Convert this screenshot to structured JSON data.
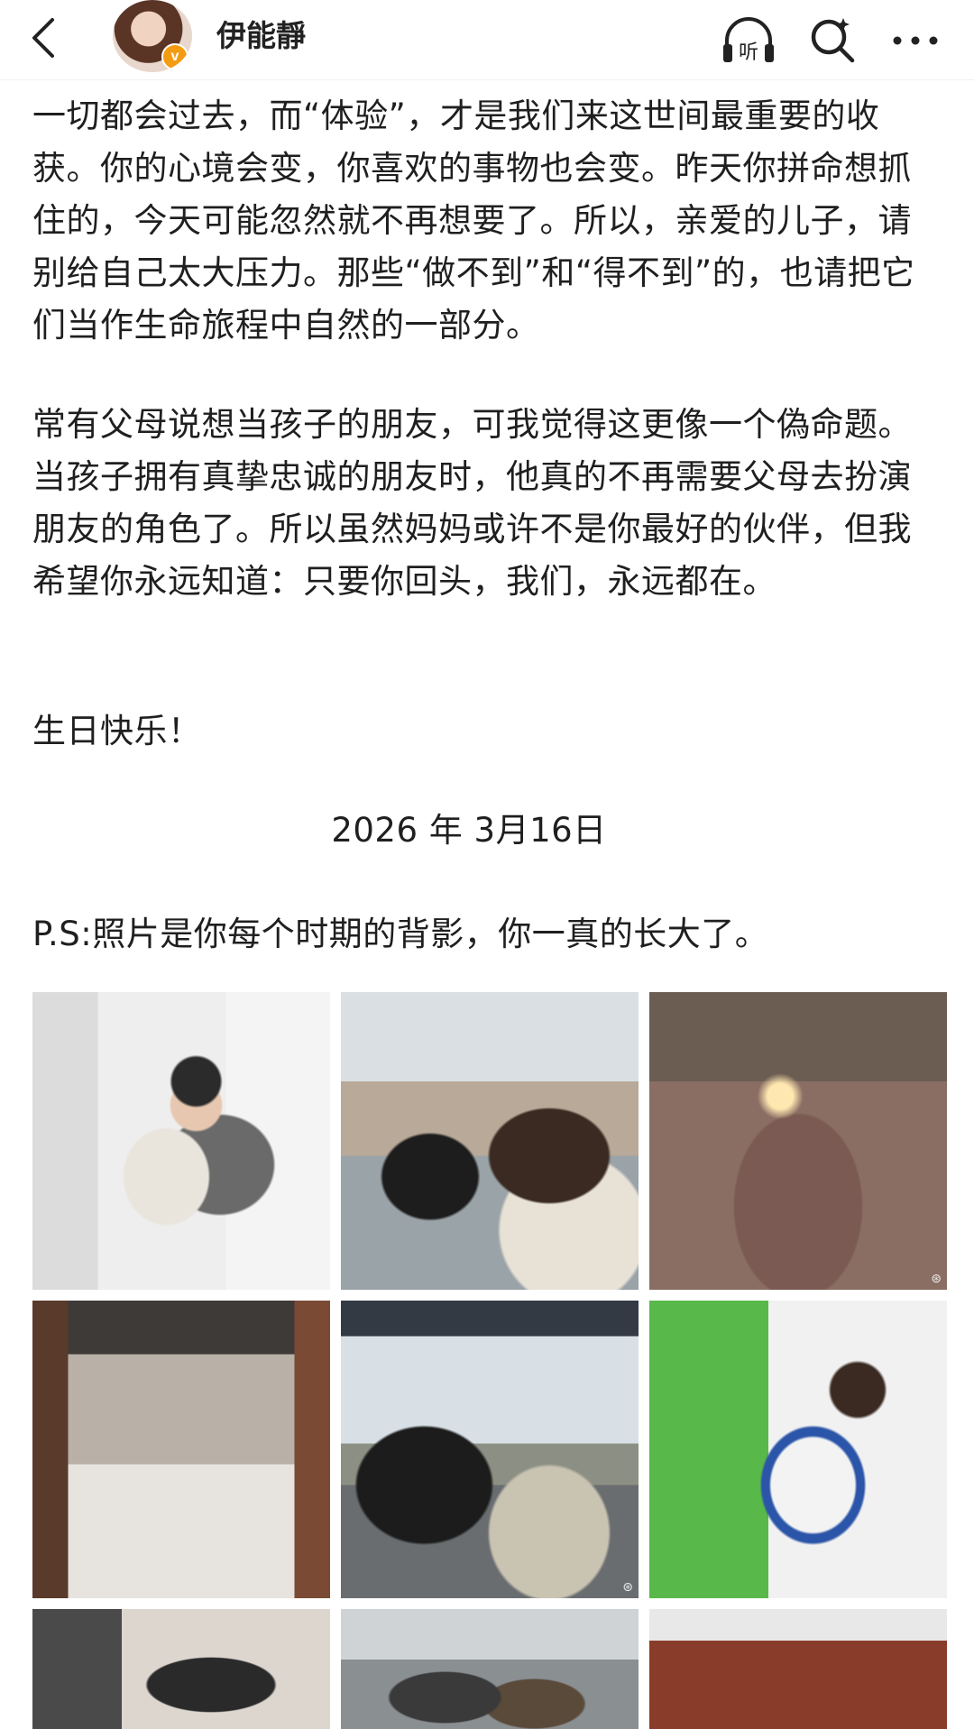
{
  "header": {
    "username": "伊能靜",
    "avatar_badge": "v",
    "icons": {
      "back": "chevron-left-icon",
      "listen": "headphones-listen-icon",
      "listen_label": "听",
      "search": "search-icon",
      "more": "more-dots-icon"
    }
  },
  "post": {
    "paragraph1": "一切都会过去，而“体验”，才是我们来这世间最重要的收获。你的心境会变，你喜欢的事物也会变。昨天你拼命想抓住的，今天可能忽然就不再想要了。所以，亲爱的儿子，请别给自己太大压力。那些“做不到”和“得不到”的，也请把它们当作生命旅程中自然的一部分。",
    "paragraph2": "常有父母说想当孩子的朋友，可我觉得这更像一个偽命题。当孩子拥有真挚忠诚的朋友时，他真的不再需要父母去扮演朋友的角色了。所以虽然妈妈或许不是你最好的伙伴，但我希望你永远知道：只要你回头，我们，永远都在。",
    "paragraph3": "生日快乐！",
    "date": "2026 年 3月16日",
    "ps": "P.S:照片是你每个时期的背影，你一真的长大了。"
  },
  "photos": [
    {
      "name": "photo-1"
    },
    {
      "name": "photo-2"
    },
    {
      "name": "photo-3",
      "watermark": "⊛"
    },
    {
      "name": "photo-4"
    },
    {
      "name": "photo-5",
      "watermark": "⊛"
    },
    {
      "name": "photo-6"
    },
    {
      "name": "photo-7"
    },
    {
      "name": "photo-8"
    },
    {
      "name": "photo-9"
    }
  ]
}
